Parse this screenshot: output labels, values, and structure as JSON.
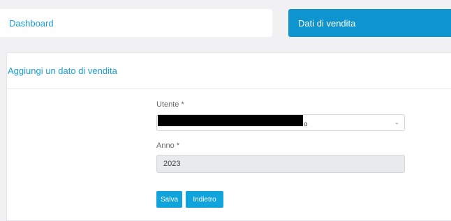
{
  "nav": {
    "dashboard_label": "Dashboard",
    "sales_data_label": "Dati di vendita"
  },
  "panel": {
    "title": "Aggiungi un dato di vendita"
  },
  "form": {
    "user": {
      "label": "Utente *",
      "visible_value_suffix": "o"
    },
    "year": {
      "label": "Anno *",
      "value": "2023"
    },
    "buttons": {
      "save": "Salva",
      "back": "Indietro"
    }
  },
  "colors": {
    "accent": "#11a3dc",
    "active_tab": "#0e94cf",
    "background": "#f1f1f3"
  },
  "icons": {
    "select_arrow": "chevron-down-icon"
  }
}
